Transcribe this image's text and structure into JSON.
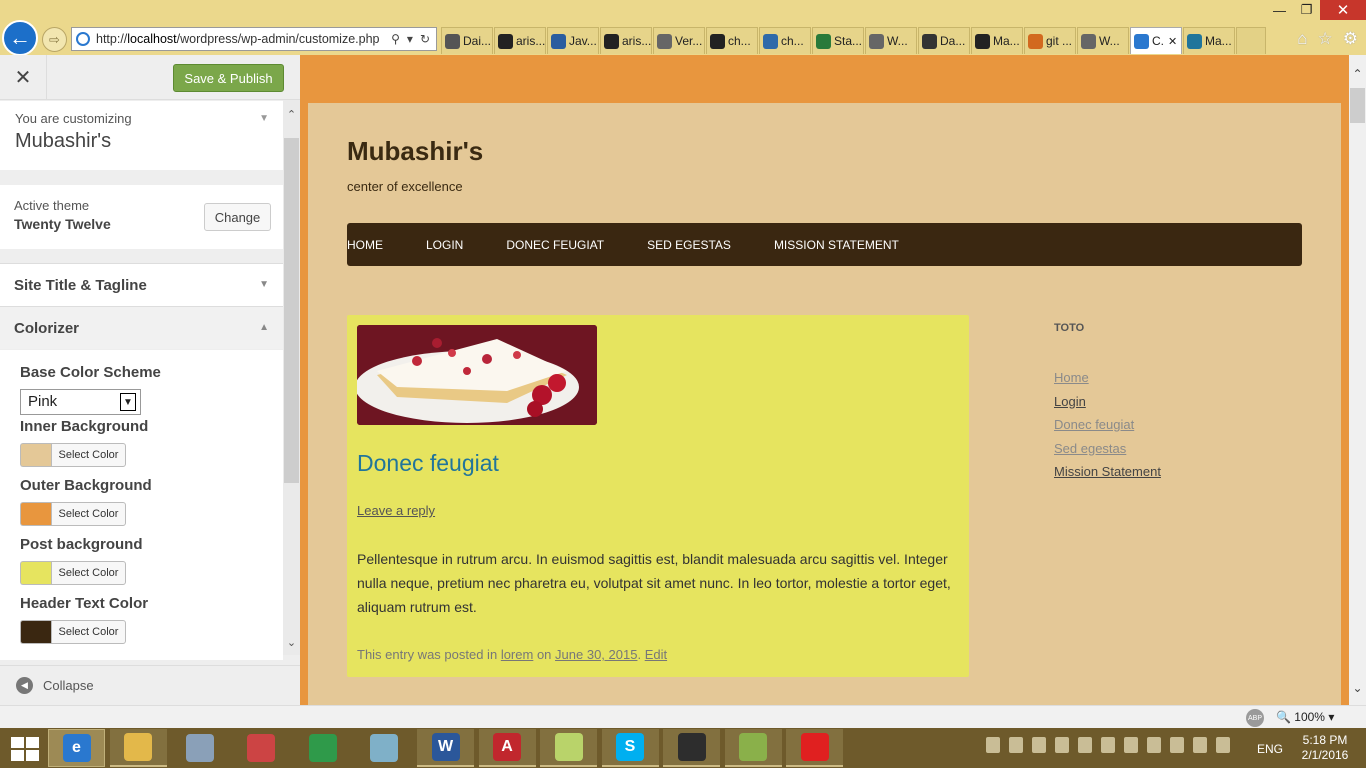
{
  "browser": {
    "url_prefix": "http://",
    "url_host": "localhost",
    "url_path": "/wordpress/wp-admin/customize.php",
    "tabs": [
      {
        "label": "Dai...",
        "icon": "daily-icon",
        "color": "#555"
      },
      {
        "label": "aris...",
        "icon": "github-icon",
        "color": "#222"
      },
      {
        "label": "Jav...",
        "icon": "java-icon",
        "color": "#2a5d9f"
      },
      {
        "label": "aris...",
        "icon": "github-icon",
        "color": "#222"
      },
      {
        "label": "Ver...",
        "icon": "wordpress-icon",
        "color": "#666"
      },
      {
        "label": "ch...",
        "icon": "github-icon",
        "color": "#222"
      },
      {
        "label": "ch...",
        "icon": "page-icon",
        "color": "#2f6aa9"
      },
      {
        "label": "Sta...",
        "icon": "dollar-icon",
        "color": "#2a7a3a"
      },
      {
        "label": "W...",
        "icon": "wordpress-icon",
        "color": "#666"
      },
      {
        "label": "Da...",
        "icon": "star-icon",
        "color": "#333"
      },
      {
        "label": "Ma...",
        "icon": "github-icon",
        "color": "#222"
      },
      {
        "label": "git ...",
        "icon": "stack-icon",
        "color": "#d2691e"
      },
      {
        "label": "W...",
        "icon": "wordpress-icon",
        "color": "#666"
      },
      {
        "label": "C.",
        "icon": "ie-icon",
        "color": "#2a78cf",
        "active": true
      },
      {
        "label": "Ma...",
        "icon": "wordpress-icon",
        "color": "#21759b"
      }
    ],
    "zoom": "100%"
  },
  "customizer": {
    "save_label": "Save & Publish",
    "customizing_label": "You are customizing",
    "site_name": "Mubashir's",
    "active_theme_label": "Active theme",
    "theme_name": "Twenty Twelve",
    "change_label": "Change",
    "section_title_tagline": "Site Title & Tagline",
    "section_colorizer": "Colorizer",
    "base_scheme_label": "Base Color Scheme",
    "base_scheme_value": "Pink",
    "select_color_label": "Select Color",
    "colors": [
      {
        "label": "Inner Background",
        "value": "#e4c897"
      },
      {
        "label": "Outer Background",
        "value": "#e8963e"
      },
      {
        "label": "Post background",
        "value": "#e6e45f"
      },
      {
        "label": "Header Text Color",
        "value": "#3a2711"
      }
    ],
    "collapse_label": "Collapse"
  },
  "site": {
    "title": "Mubashir's",
    "tagline": "center of excellence",
    "menu": [
      "HOME",
      "LOGIN",
      "DONEC FEUGIAT",
      "SED EGESTAS",
      "MISSION STATEMENT"
    ],
    "post": {
      "title": "Donec feugiat",
      "reply": "Leave a reply",
      "body": "Pellentesque in rutrum arcu. In euismod sagittis est, blandit malesuada arcu sagittis vel. Integer nulla neque, pretium nec pharetra eu, volutpat sit amet nunc. In leo tortor, molestie a tortor eget, aliquam rutrum est.",
      "meta_prefix": "This entry was posted in",
      "category": "lorem",
      "meta_on": "on",
      "date": "June 30, 2015",
      "edit": "Edit"
    },
    "widget_title": "TOTO",
    "widget_links": [
      {
        "label": "Home",
        "color": "#8a8a8a"
      },
      {
        "label": "Login",
        "color": "#444444"
      },
      {
        "label": "Donec feugiat",
        "color": "#8a8a8a"
      },
      {
        "label": "Sed egestas",
        "color": "#8a8a8a"
      },
      {
        "label": "Mission Statement",
        "color": "#444444"
      }
    ]
  },
  "taskbar": {
    "apps": [
      {
        "name": "internet-explorer",
        "color": "#2a78cf",
        "glyph": "e",
        "state": "active"
      },
      {
        "name": "file-explorer",
        "color": "#e3b84a",
        "glyph": "",
        "state": "open"
      },
      {
        "name": "calculator",
        "color": "#8aa0b8",
        "glyph": "",
        "state": ""
      },
      {
        "name": "snipping-tool",
        "color": "#c44",
        "glyph": "",
        "state": ""
      },
      {
        "name": "chrome",
        "color": "#2f9a4a",
        "glyph": "",
        "state": ""
      },
      {
        "name": "notepad-plus",
        "color": "#7fb0c8",
        "glyph": "",
        "state": ""
      },
      {
        "name": "word",
        "color": "#2b579a",
        "glyph": "W",
        "state": "open"
      },
      {
        "name": "acrobat",
        "color": "#c1272d",
        "glyph": "A",
        "state": "open"
      },
      {
        "name": "sticky-folder",
        "color": "#b9d36a",
        "glyph": "",
        "state": "open"
      },
      {
        "name": "skype",
        "color": "#00aff0",
        "glyph": "S",
        "state": "open"
      },
      {
        "name": "terminal",
        "color": "#2d2d2d",
        "glyph": "",
        "state": "open"
      },
      {
        "name": "notepad-pp",
        "color": "#8ab04a",
        "glyph": "",
        "state": "open"
      },
      {
        "name": "paint-splash",
        "color": "#e02020",
        "glyph": "",
        "state": "open"
      }
    ],
    "lang": "ENG",
    "time": "5:18 PM",
    "date": "2/1/2016"
  }
}
